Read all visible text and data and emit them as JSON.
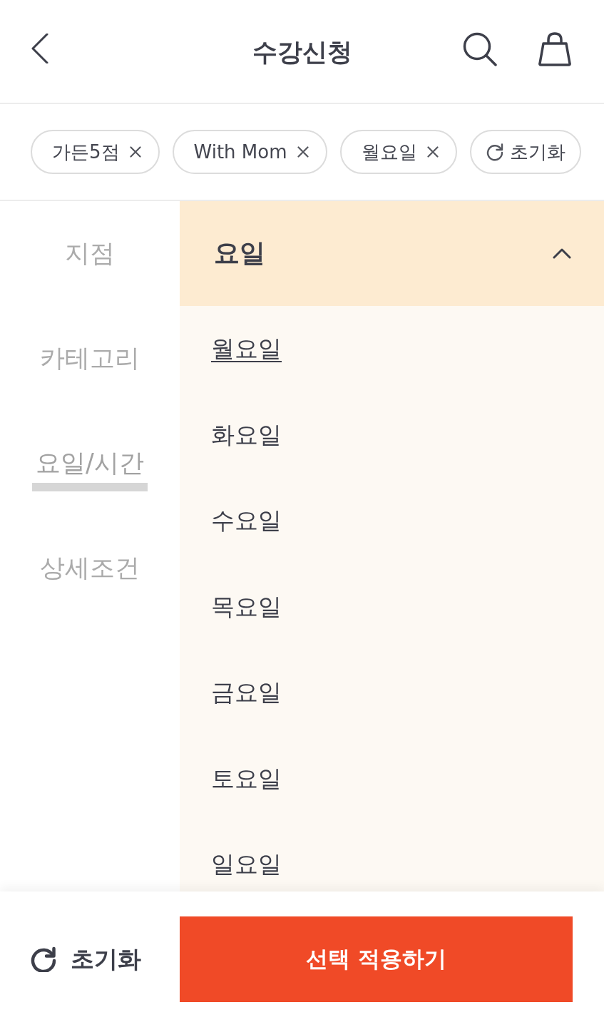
{
  "header": {
    "title": "수강신청"
  },
  "filter_chips": [
    {
      "kind": "filter",
      "label": "가든5점"
    },
    {
      "kind": "filter",
      "label": "With Mom"
    },
    {
      "kind": "filter",
      "label": "월요일"
    },
    {
      "kind": "reset",
      "label": "초기화"
    }
  ],
  "sidebar": {
    "items": [
      {
        "label": "지점",
        "selected": false
      },
      {
        "label": "카테고리",
        "selected": false
      },
      {
        "label": "요일/시간",
        "selected": true
      },
      {
        "label": "상세조건",
        "selected": false
      }
    ]
  },
  "section": {
    "title": "요일",
    "expanded": true,
    "options": [
      {
        "label": "월요일",
        "selected": true
      },
      {
        "label": "화요일",
        "selected": false
      },
      {
        "label": "수요일",
        "selected": false
      },
      {
        "label": "목요일",
        "selected": false
      },
      {
        "label": "금요일",
        "selected": false
      },
      {
        "label": "토요일",
        "selected": false
      },
      {
        "label": "일요일",
        "selected": false
      }
    ]
  },
  "footer": {
    "reset_label": "초기화",
    "apply_label": "선택 적용하기"
  }
}
